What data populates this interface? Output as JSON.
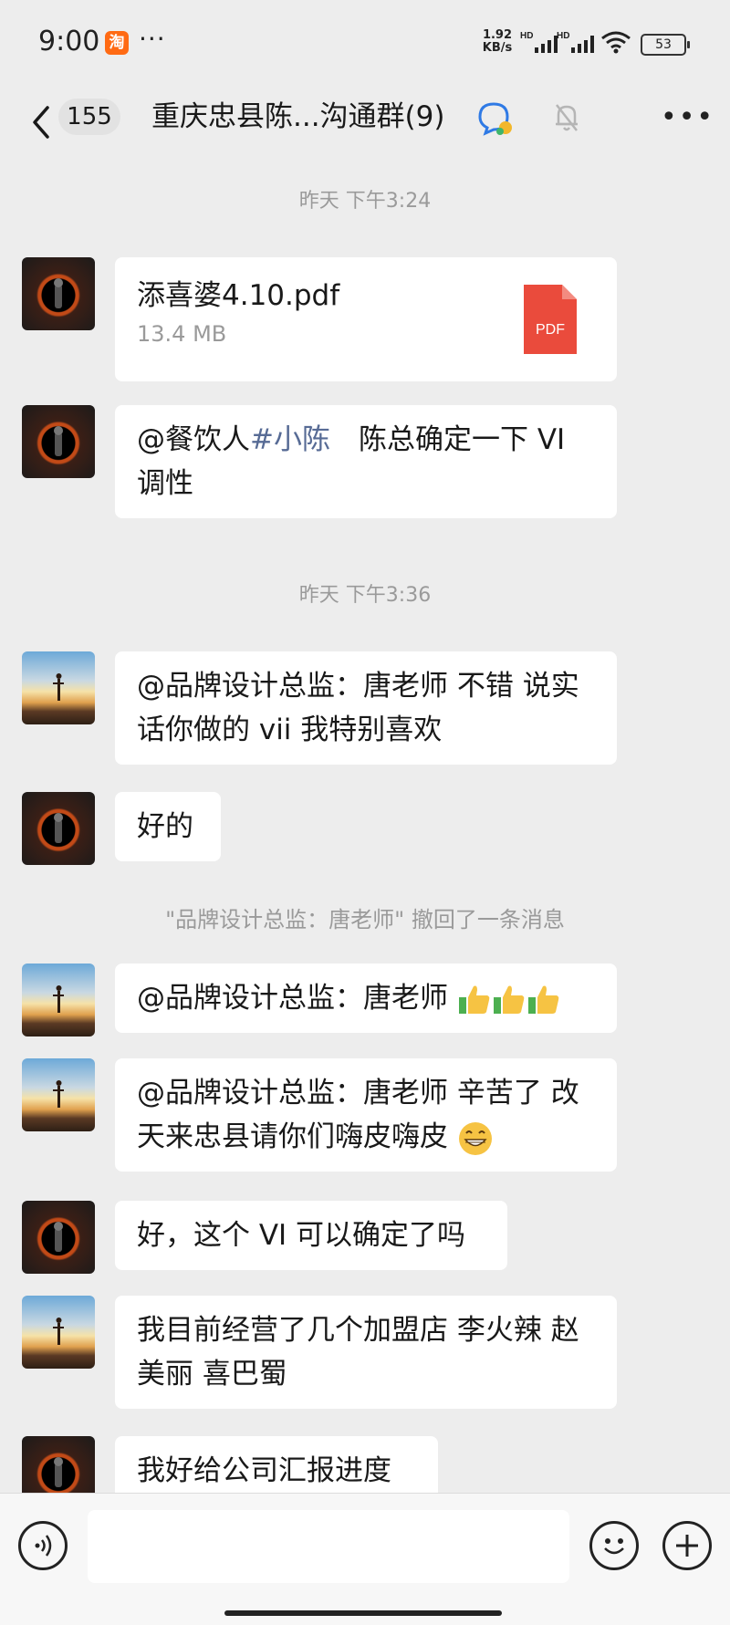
{
  "status_bar": {
    "time": "9:00",
    "app_badge": "淘",
    "more": "···",
    "net_speed_value": "1.92",
    "net_speed_unit": "KB/s",
    "signal_labels": [
      "HD",
      "HD"
    ],
    "battery": "53"
  },
  "nav": {
    "unread_count": "155",
    "title": "重庆忠县陈...沟通群(9)"
  },
  "messages": {
    "time1": "昨天 下午3:24",
    "file_name": "添喜婆4.10.pdf",
    "file_size": "13.4 MB",
    "file_type": "PDF",
    "m2_mention": "@餐饮人",
    "m2_tag": "#小陈",
    "m2_text": "　陈总确定一下 VI 调性",
    "time2": "昨天 下午3:36",
    "m3_text": "@品牌设计总监：唐老师  不错 说实话你做的 vii 我特别喜欢",
    "m4_text": "好的",
    "recall_note": "\"品牌设计总监：唐老师\" 撤回了一条消息",
    "m5_text": "@品牌设计总监：唐老师 ",
    "m6_text": "@品牌设计总监：唐老师  辛苦了 改天来忠县请你们嗨皮嗨皮",
    "m7_text": "好，这个 VI 可以确定了吗",
    "m8_text": "我目前经营了几个加盟店 李火辣 赵美丽 喜巴蜀",
    "m9_text": "我好给公司汇报进度"
  },
  "input": {
    "value": "",
    "placeholder": ""
  },
  "icons": {
    "back": "chevron-left-icon",
    "group": "chat-bubbles-icon",
    "mute": "bell-off-icon",
    "more": "more-horizontal-icon",
    "voice": "voice-icon",
    "emoji": "smile-icon",
    "plus": "plus-icon",
    "thumbs": "thumbs-up-icon",
    "grin": "grin-emoji-icon"
  },
  "colors": {
    "background": "#ededed",
    "bubble": "#ffffff",
    "mention": "#576b95",
    "timestamp": "#9a9a9a",
    "pdf_red": "#ea4b3c"
  }
}
